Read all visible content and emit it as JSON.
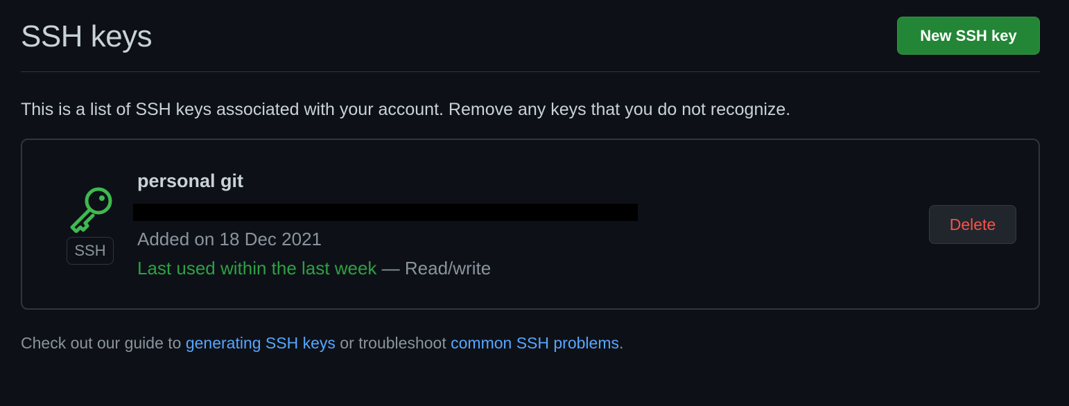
{
  "header": {
    "title": "SSH keys",
    "new_key_label": "New SSH key"
  },
  "intro": "This is a list of SSH keys associated with your account. Remove any keys that you do not recognize.",
  "keys": [
    {
      "icon": "key-icon",
      "type_label": "SSH",
      "title": "personal git",
      "fingerprint": "",
      "added": "Added on 18 Dec 2021",
      "last_used": "Last used within the last week",
      "access": "— Read/write",
      "delete_label": "Delete"
    }
  ],
  "footer": {
    "prefix": "Check out our guide to ",
    "link1": "generating SSH keys",
    "middle": " or troubleshoot ",
    "link2": "common SSH problems",
    "suffix": "."
  },
  "colors": {
    "background": "#0d1117",
    "primary_button": "#238636",
    "danger_text": "#f85149",
    "success_text": "#2ea043",
    "link": "#58a6ff"
  }
}
